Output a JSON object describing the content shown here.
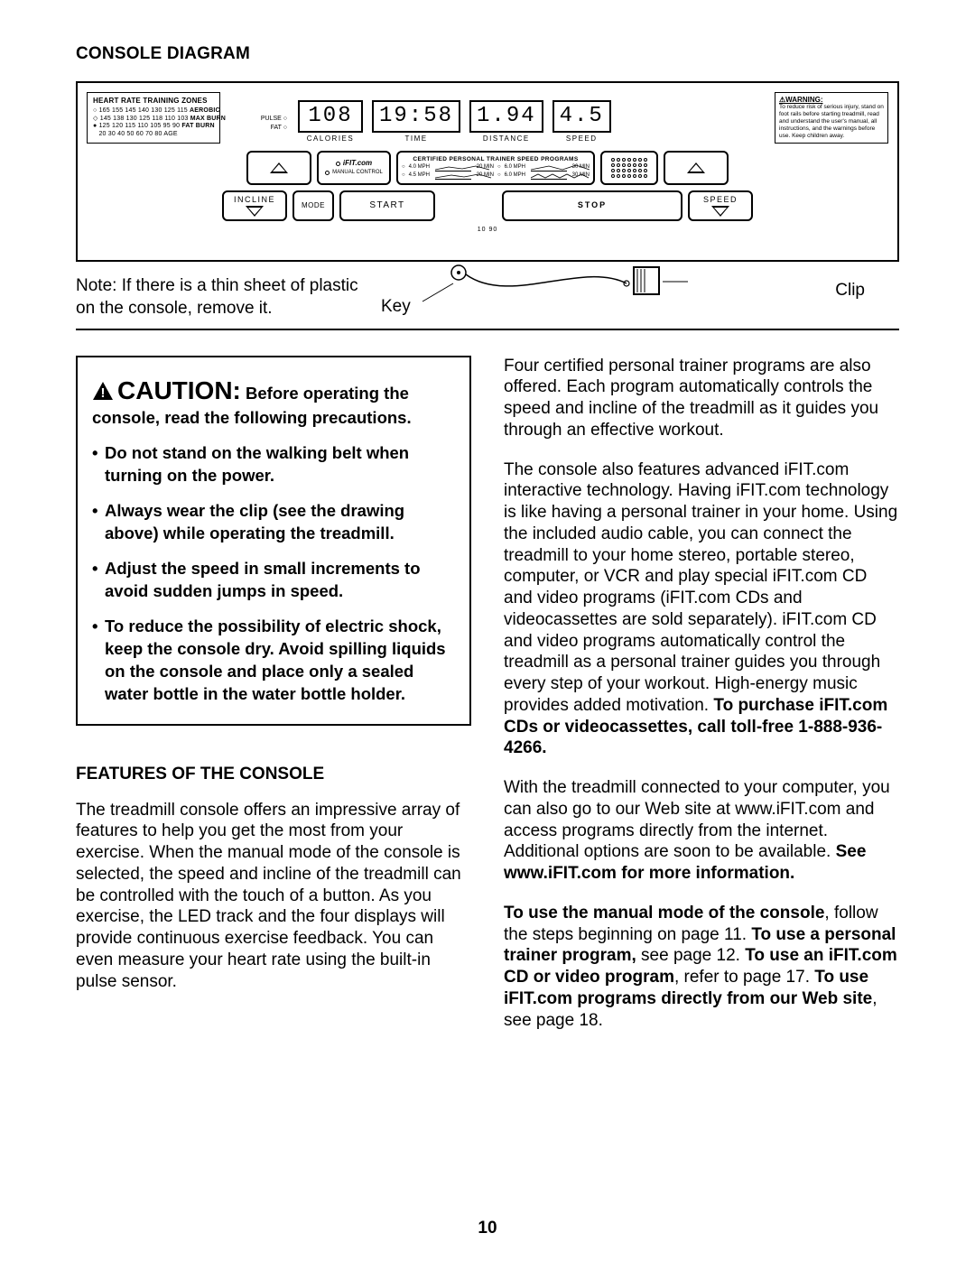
{
  "heading": "CONSOLE DIAGRAM",
  "console": {
    "hr_zones": {
      "title": "HEART RATE TRAINING ZONES",
      "row1_nums": "165 155 145 140 130 125 115",
      "row1_label": "AEROBIC",
      "row2_nums": "145 138 130 125 118 110 103",
      "row2_label": "MAX BURN",
      "row3_nums": "125 120 115 110 105  95  90",
      "row3_label": "FAT BURN",
      "row4_nums": " 20  30  40  50  60  70  80",
      "row4_label": "AGE"
    },
    "pf_label_pulse": "PULSE ○",
    "pf_label_fat": "FAT ○",
    "displays": {
      "calories": {
        "value": "108",
        "label": "CALORIES"
      },
      "time": {
        "value": "19:58",
        "label": "TIME"
      },
      "distance": {
        "value": "1.94",
        "label": "DISTANCE"
      },
      "speed": {
        "value": "4.5",
        "label": "SPEED"
      }
    },
    "warning_box": {
      "title": "⚠WARNING:",
      "text": "To reduce risk of serious injury, stand on foot rails before starting treadmill, read and understand the user's manual, all instructions, and the warnings before use. Keep children away."
    },
    "ifit": {
      "logo": "iFIT.com",
      "manual": "MANUAL CONTROL"
    },
    "programs": {
      "title": "CERTIFIED PERSONAL TRAINER SPEED PROGRAMS",
      "p1_left": "4.0 MPH",
      "p1_right": "20 MIN",
      "p2_left": "6.0 MPH",
      "p2_right": "30 MIN",
      "p3_left": "4.5 MPH",
      "p3_right": "20 MIN",
      "p4_left": "6.0 MPH",
      "p4_right": "30 MIN"
    },
    "buttons": {
      "incline": "INCLINE",
      "mode": "MODE",
      "start": "START",
      "stop": "STOP",
      "speed": "SPEED"
    },
    "footer": "10   90"
  },
  "annot": {
    "note": "Note: If there is a thin sheet of plastic on the console, remove it.",
    "key": "Key",
    "clip": "Clip"
  },
  "caution": {
    "title": "CAUTION:",
    "lead": "Before operating the console, read the following precautions.",
    "items": [
      "Do not stand on the walking belt when turning on the power.",
      "Always wear the clip (see the drawing above) while operating the treadmill.",
      "Adjust the speed in small increments to avoid sudden jumps in speed.",
      "To reduce the possibility of electric shock, keep the console dry. Avoid spilling liquids on the console and place only a sealed water bottle in the water bottle holder."
    ]
  },
  "features": {
    "heading": "FEATURES OF THE CONSOLE",
    "p1": "The treadmill console offers an impressive array of features to help you get the most from your exercise. When the manual mode of the console is selected, the speed and incline of the treadmill can be controlled with the touch of a button. As you exercise, the LED track and the four displays will provide continuous exercise feedback. You can even measure your heart rate using the built-in pulse sensor."
  },
  "right": {
    "p1": "Four certified personal trainer programs are also offered. Each program automatically controls the speed and incline of the treadmill as it guides you through an effective workout.",
    "p2a": "The console also features advanced iFIT.com interactive technology. Having iFIT.com technology is like having a personal trainer in your home. Using the included audio cable, you can connect the treadmill to your home stereo, portable stereo, computer, or VCR and play special iFIT.com CD and video programs (iFIT.com CDs and videocassettes are sold separately). iFIT.com CD and video programs automatically control the treadmill as a personal trainer guides you through every step of your workout. High-energy music provides added motivation. ",
    "p2b": "To purchase iFIT.com CDs or videocassettes, call toll-free 1-888-936-4266.",
    "p3a": "With the treadmill connected to your computer, you can also go to our Web site at www.iFIT.com and access programs directly from the internet. Additional options are soon to be available. ",
    "p3b": "See www.iFIT.com for more information.",
    "p4_1b": "To use the manual mode of the console",
    "p4_1": ", follow the steps beginning on page 11. ",
    "p4_2b": "To use a personal trainer program,",
    "p4_2": " see page 12. ",
    "p4_3b": "To use an iFIT.com CD or video program",
    "p4_3": ", refer to page 17. ",
    "p4_4b": "To use iFIT.com programs directly from our Web site",
    "p4_4": ", see page 18."
  },
  "page_number": "10"
}
